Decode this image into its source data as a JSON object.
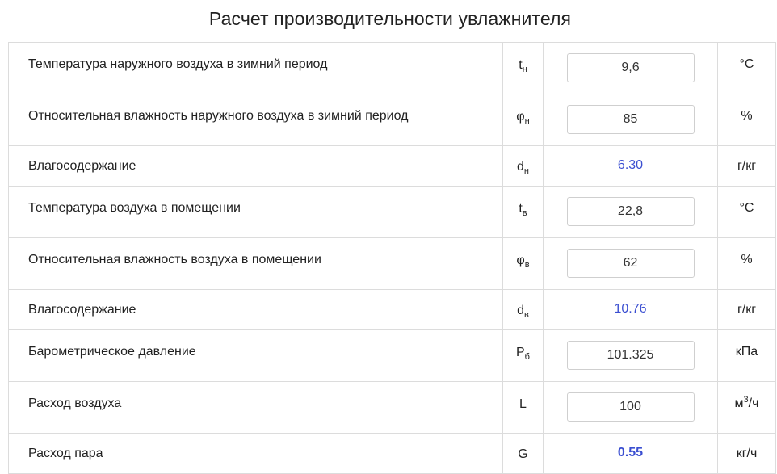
{
  "title": "Расчет производительности увлажнителя",
  "colors": {
    "result": "#3b4fd1",
    "border": "#dcdcdc"
  },
  "rows": [
    {
      "label": "Температура наружного воздуха в зимний период",
      "symbol": "t",
      "symbol_sub": "н",
      "value": "9,6",
      "unit": "°C"
    },
    {
      "label": "Относительная влажность наружного воздуха в зимний период",
      "symbol": "φ",
      "symbol_sub": "н",
      "value": "85",
      "unit": "%"
    },
    {
      "label": "Влагосодержание",
      "symbol": "d",
      "symbol_sub": "н",
      "value": "6.30",
      "unit": "г/кг"
    },
    {
      "label": "Температура воздуха в помещении",
      "symbol": "t",
      "symbol_sub": "в",
      "value": "22,8",
      "unit": "°C"
    },
    {
      "label": "Относительная влажность воздуха в помещении",
      "symbol": "φ",
      "symbol_sub": "в",
      "value": "62",
      "unit": "%"
    },
    {
      "label": "Влагосодержание",
      "symbol": "d",
      "symbol_sub": "в",
      "value": "10.76",
      "unit": "г/кг"
    },
    {
      "label": "Барометрическое давление",
      "symbol": "P",
      "symbol_sub": "б",
      "value": "101.325",
      "unit": "кПа"
    },
    {
      "label": "Расход воздуха",
      "symbol": "L",
      "value": "100",
      "unit": "м",
      "unit_sup": "3",
      "unit_after": "/ч"
    },
    {
      "label": "Расход пара",
      "symbol": "G",
      "value": "0.55",
      "unit": "кг/ч"
    }
  ]
}
